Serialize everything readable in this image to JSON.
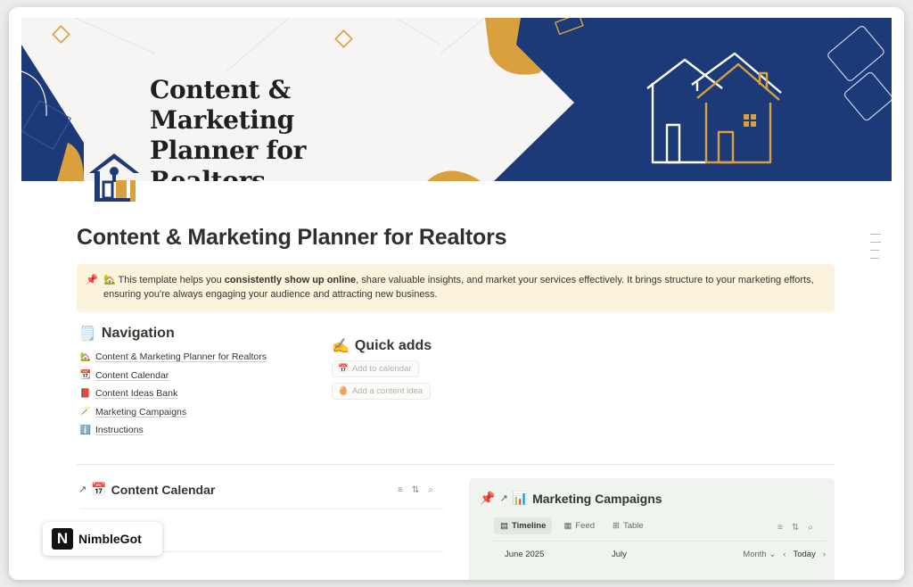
{
  "cover": {
    "title_lines": [
      "Content & Marketing",
      "Planner for",
      "Realtors"
    ],
    "colors": {
      "navy": "#1d3a78",
      "gold": "#d9a03d",
      "cream": "#f6f5f3"
    }
  },
  "page": {
    "icon": "house-logo-icon",
    "title": "Content & Marketing Planner for Realtors"
  },
  "callout": {
    "pin_icon": "📌",
    "emoji": "🏡",
    "text_before": " This template helps you ",
    "text_bold": "consistently show up online",
    "text_after": ", share valuable insights, and market your services effectively. It brings structure to your marketing efforts, ensuring you're always engaging your audience and attracting new business.",
    "bg": "#fbf3dc"
  },
  "navigation": {
    "emoji": "🗒️",
    "heading": "Navigation",
    "items": [
      {
        "icon": "🏡",
        "label": "Content & Marketing Planner for Realtors"
      },
      {
        "icon": "📆",
        "label": "Content Calendar"
      },
      {
        "icon": "📕",
        "label": "Content Ideas Bank"
      },
      {
        "icon": "🪄",
        "label": "Marketing Campaigns"
      },
      {
        "icon": "ℹ️",
        "label": "Instructions"
      }
    ]
  },
  "quick_adds": {
    "emoji": "✍️",
    "heading": "Quick adds",
    "buttons": [
      {
        "icon": "📅",
        "label": "Add to calendar"
      },
      {
        "icon": "🥚",
        "label": "Add a content idea"
      }
    ]
  },
  "content_calendar": {
    "arrow": "↗",
    "emoji": "📅",
    "title": "Content Calendar"
  },
  "marketing_campaigns": {
    "pin": "📌",
    "arrow": "↗",
    "emoji": "📊",
    "title": "Marketing Campaigns",
    "tabs": [
      {
        "icon": "▤",
        "label": "Timeline",
        "active": true
      },
      {
        "icon": "▦",
        "label": "Feed",
        "active": false
      },
      {
        "icon": "⊞",
        "label": "Table",
        "active": false
      }
    ],
    "month_left": "June 2025",
    "month_right": "July",
    "view_select": "Month",
    "today": "Today"
  },
  "brand": {
    "logo_letter": "N",
    "name": "NimbleGot"
  }
}
